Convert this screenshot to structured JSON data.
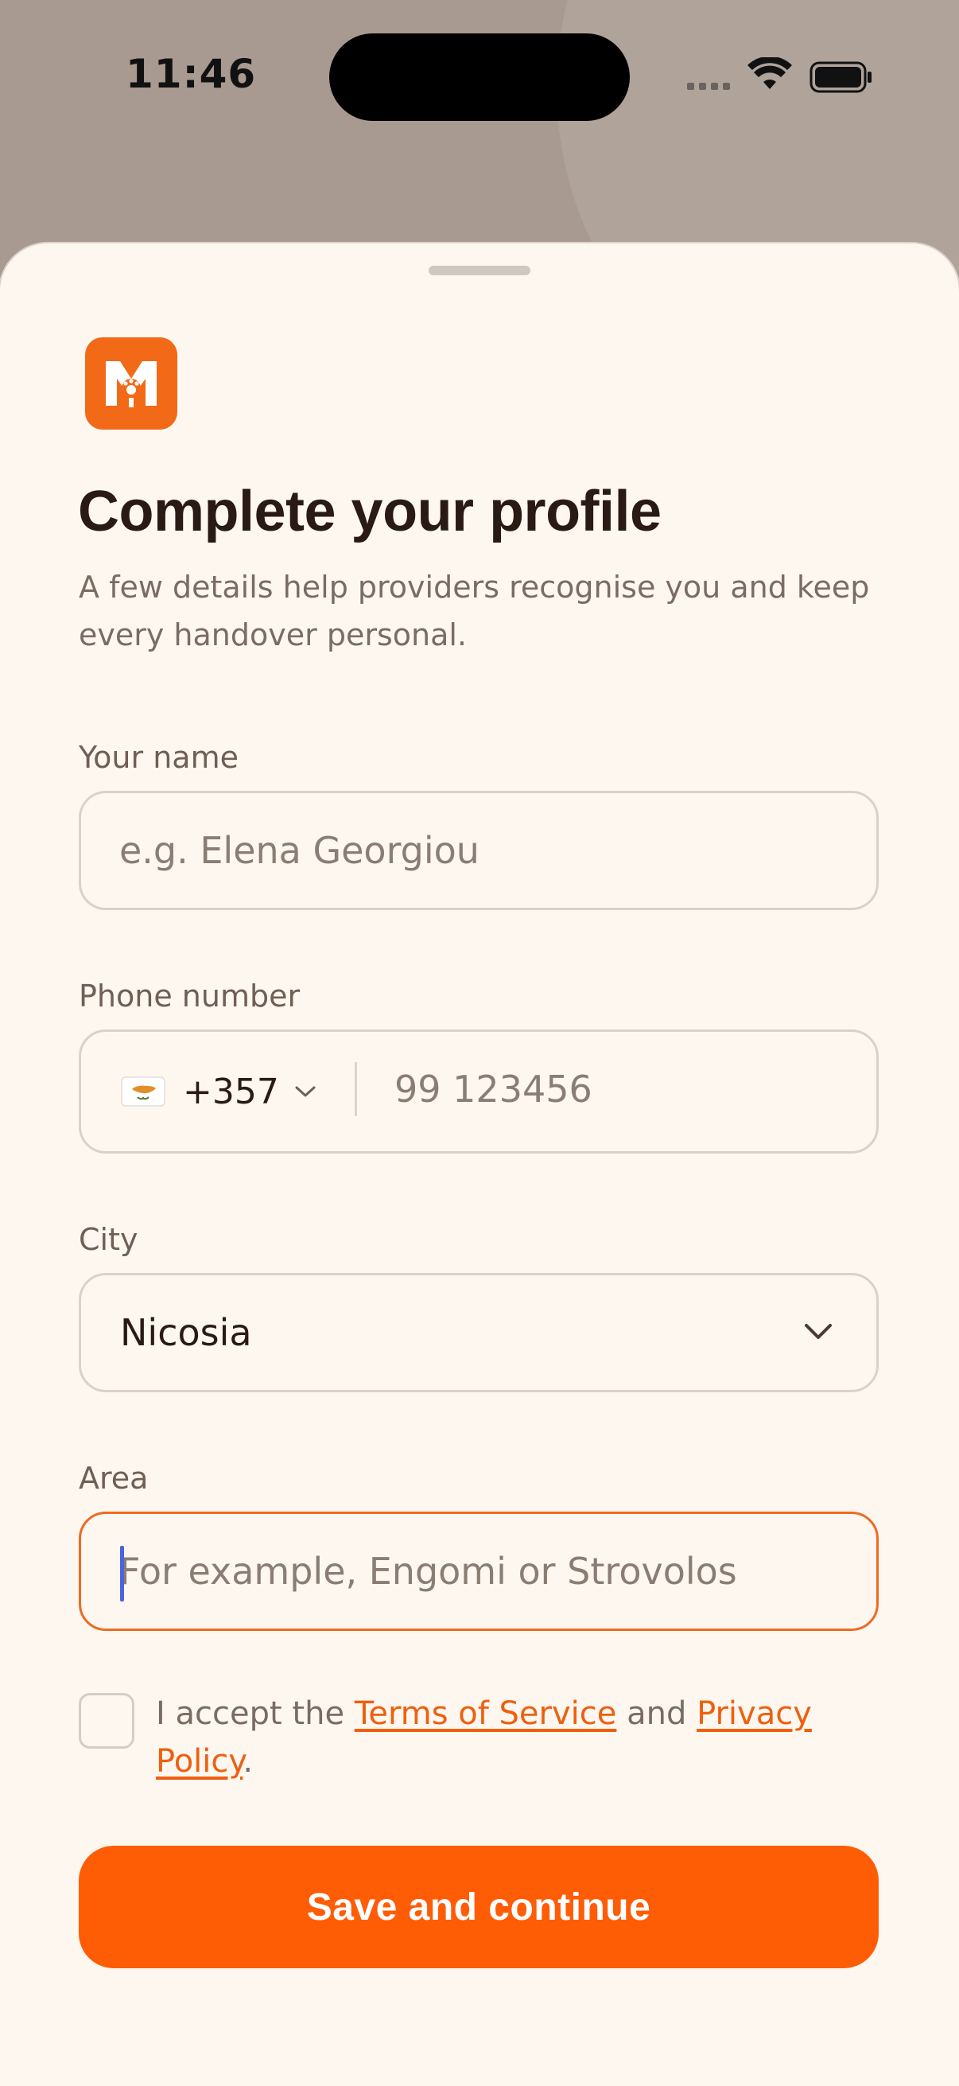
{
  "status_bar": {
    "time": "11:46"
  },
  "colors": {
    "accent": "#ff5c06",
    "link": "#ef5f0f",
    "focus_border": "#ef6a22",
    "sheet_background": "#fdf7f0",
    "title_text": "#2a1a14"
  },
  "header": {
    "logo_icon": "app-logo-icon",
    "title": "Complete your profile",
    "subtitle": "A few details help providers recognise you and keep every handover personal."
  },
  "form": {
    "name": {
      "label": "Your name",
      "placeholder": "e.g. Elena Georgiou",
      "value": ""
    },
    "phone": {
      "label": "Phone number",
      "country_flag": "cyprus-flag-icon",
      "dial_code": "+357",
      "placeholder": "99 123456",
      "value": ""
    },
    "city": {
      "label": "City",
      "selected": "Nicosia"
    },
    "area": {
      "label": "Area",
      "placeholder": "For example, Engomi or Strovolos",
      "value": "",
      "focused": true
    },
    "terms": {
      "checked": false,
      "prefix": "I accept the ",
      "terms_link": "Terms of Service",
      "middle": " and ",
      "privacy_link": "Privacy Policy",
      "suffix": "."
    },
    "submit_label": "Save and continue"
  }
}
